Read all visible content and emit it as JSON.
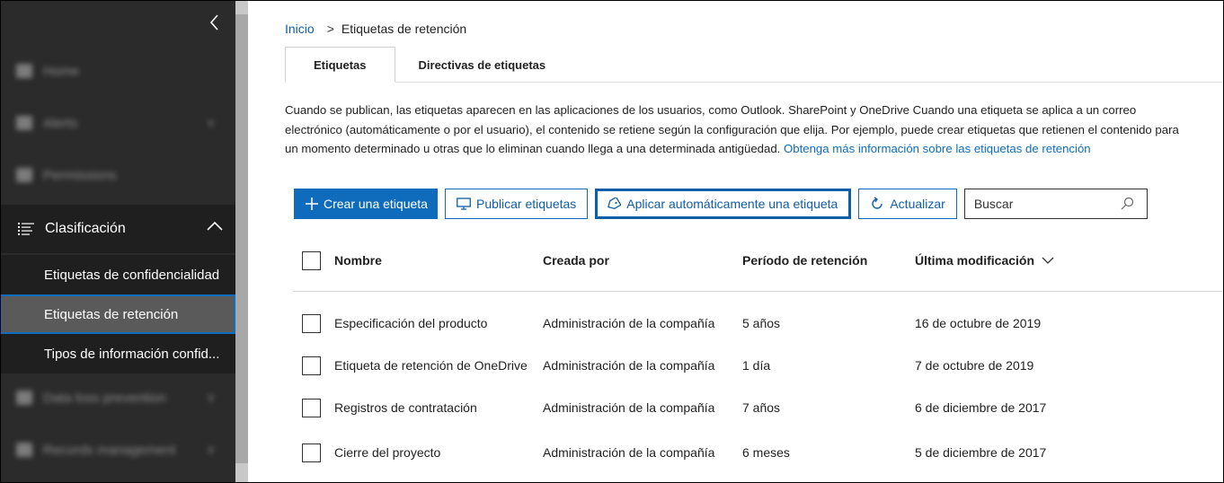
{
  "sidebar": {
    "blurred_items": [
      {
        "label": "Home"
      },
      {
        "label": "Alerts"
      },
      {
        "label": "Permissions"
      },
      {
        "label": "Data loss prevention"
      },
      {
        "label": "Records management"
      }
    ],
    "section": {
      "label": "Clasificación"
    },
    "subitems": [
      {
        "label": "Etiquetas de confidencialidad"
      },
      {
        "label": "Etiquetas de retención"
      },
      {
        "label": "Tipos de información confid..."
      }
    ]
  },
  "breadcrumb": {
    "home": "Inicio",
    "separator": ">",
    "current": "Etiquetas de retención"
  },
  "tabs": [
    {
      "label": "Etiquetas"
    },
    {
      "label": "Directivas de etiquetas"
    }
  ],
  "description": {
    "text": "Cuando se publican, las etiquetas aparecen en las aplicaciones de los usuarios, como Outlook. SharePoint y OneDrive Cuando una etiqueta se aplica a un correo electrónico (automáticamente o por el usuario), el contenido se retiene según la configuración que elija. Por ejemplo, puede crear etiquetas que retienen el contenido para un momento determinado u otras que lo eliminan cuando llega a una determinada antigüedad.",
    "link": "Obtenga más información sobre las etiquetas de retención"
  },
  "toolbar": {
    "create": "Crear una etiqueta",
    "publish": "Publicar etiquetas",
    "auto_apply": "Aplicar automáticamente una etiqueta",
    "refresh": "Actualizar",
    "search_placeholder": "Buscar"
  },
  "table": {
    "headers": {
      "name": "Nombre",
      "created_by": "Creada por",
      "retention": "Período de retención",
      "modified": "Última modificación"
    },
    "rows": [
      {
        "name": "Especificación del producto",
        "created_by": "Administración de la compañía",
        "retention": "5 años",
        "modified": "16 de octubre de 2019"
      },
      {
        "name": "Etiqueta de retención de OneDrive",
        "created_by": "Administración de la compañía",
        "retention": "1 día",
        "modified": "7 de octubre de 2019"
      },
      {
        "name": "Registros de contratación",
        "created_by": "Administración de la compañía",
        "retention": "7 años",
        "modified": "6 de diciembre de 2017"
      },
      {
        "name": "Cierre del proyecto",
        "created_by": "Administración de la compañía",
        "retention": "6 meses",
        "modified": "5 de diciembre de 2017"
      }
    ]
  },
  "colors": {
    "accent": "#0f6cbd",
    "sidebar_bg": "#2b2b2b",
    "active_border": "#106ebe"
  }
}
